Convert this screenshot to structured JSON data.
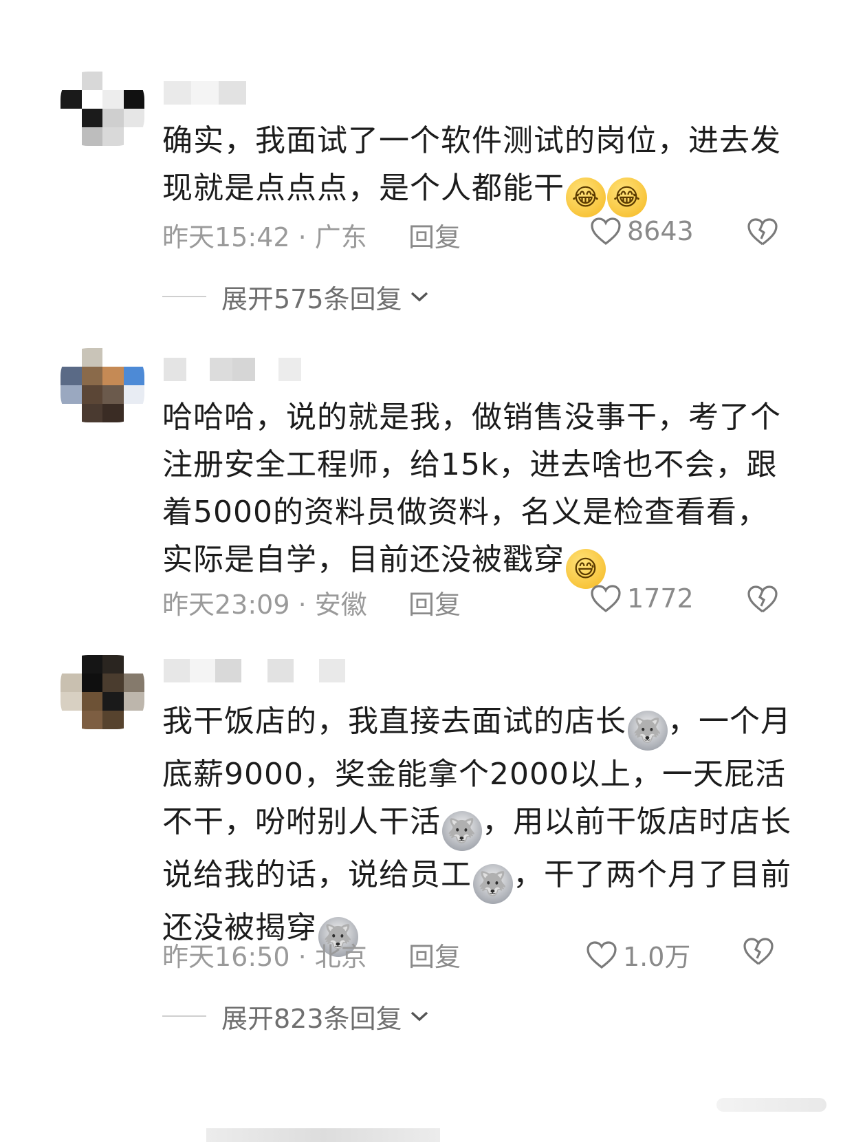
{
  "comments": [
    {
      "text": "确实，我面试了一个软件测试的岗位，进去发现就是点点点，是个人都能干",
      "emojis": [
        "😂",
        "😂"
      ],
      "time": "昨天15:42 · 广东",
      "reply_label": "回复",
      "like_count": "8643",
      "expand_label": "展开575条回复"
    },
    {
      "text": "哈哈哈，说的就是我，做销售没事干，考了个注册安全工程师，给15k，进去啥也不会，跟着5000的资料员做资料，名义是检查看看，实际是自学，目前还没被戳穿",
      "emojis": [
        "😅"
      ],
      "time": "昨天23:09 · 安徽",
      "reply_label": "回复",
      "like_count": "1772"
    },
    {
      "text_parts": [
        "我干饭店的，我直接去面试的店长",
        "，一个月底薪9000，奖金能拿个2000以上，一天屁活不干，吩咐别人干活",
        "，用以前干饭店时店长说给我的话，说给员工",
        "，干了两个月了目前还没被揭穿"
      ],
      "emojis": [
        "🐺",
        "🐺",
        "🐺",
        "🐺"
      ],
      "time": "昨天16:50 · 北京",
      "reply_label": "回复",
      "like_count": "1.0万",
      "expand_label": "展开823条回复"
    }
  ],
  "icons": {
    "like": "heart-outline-icon",
    "dislike": "broken-heart-icon",
    "expand": "chevron-down-icon"
  }
}
